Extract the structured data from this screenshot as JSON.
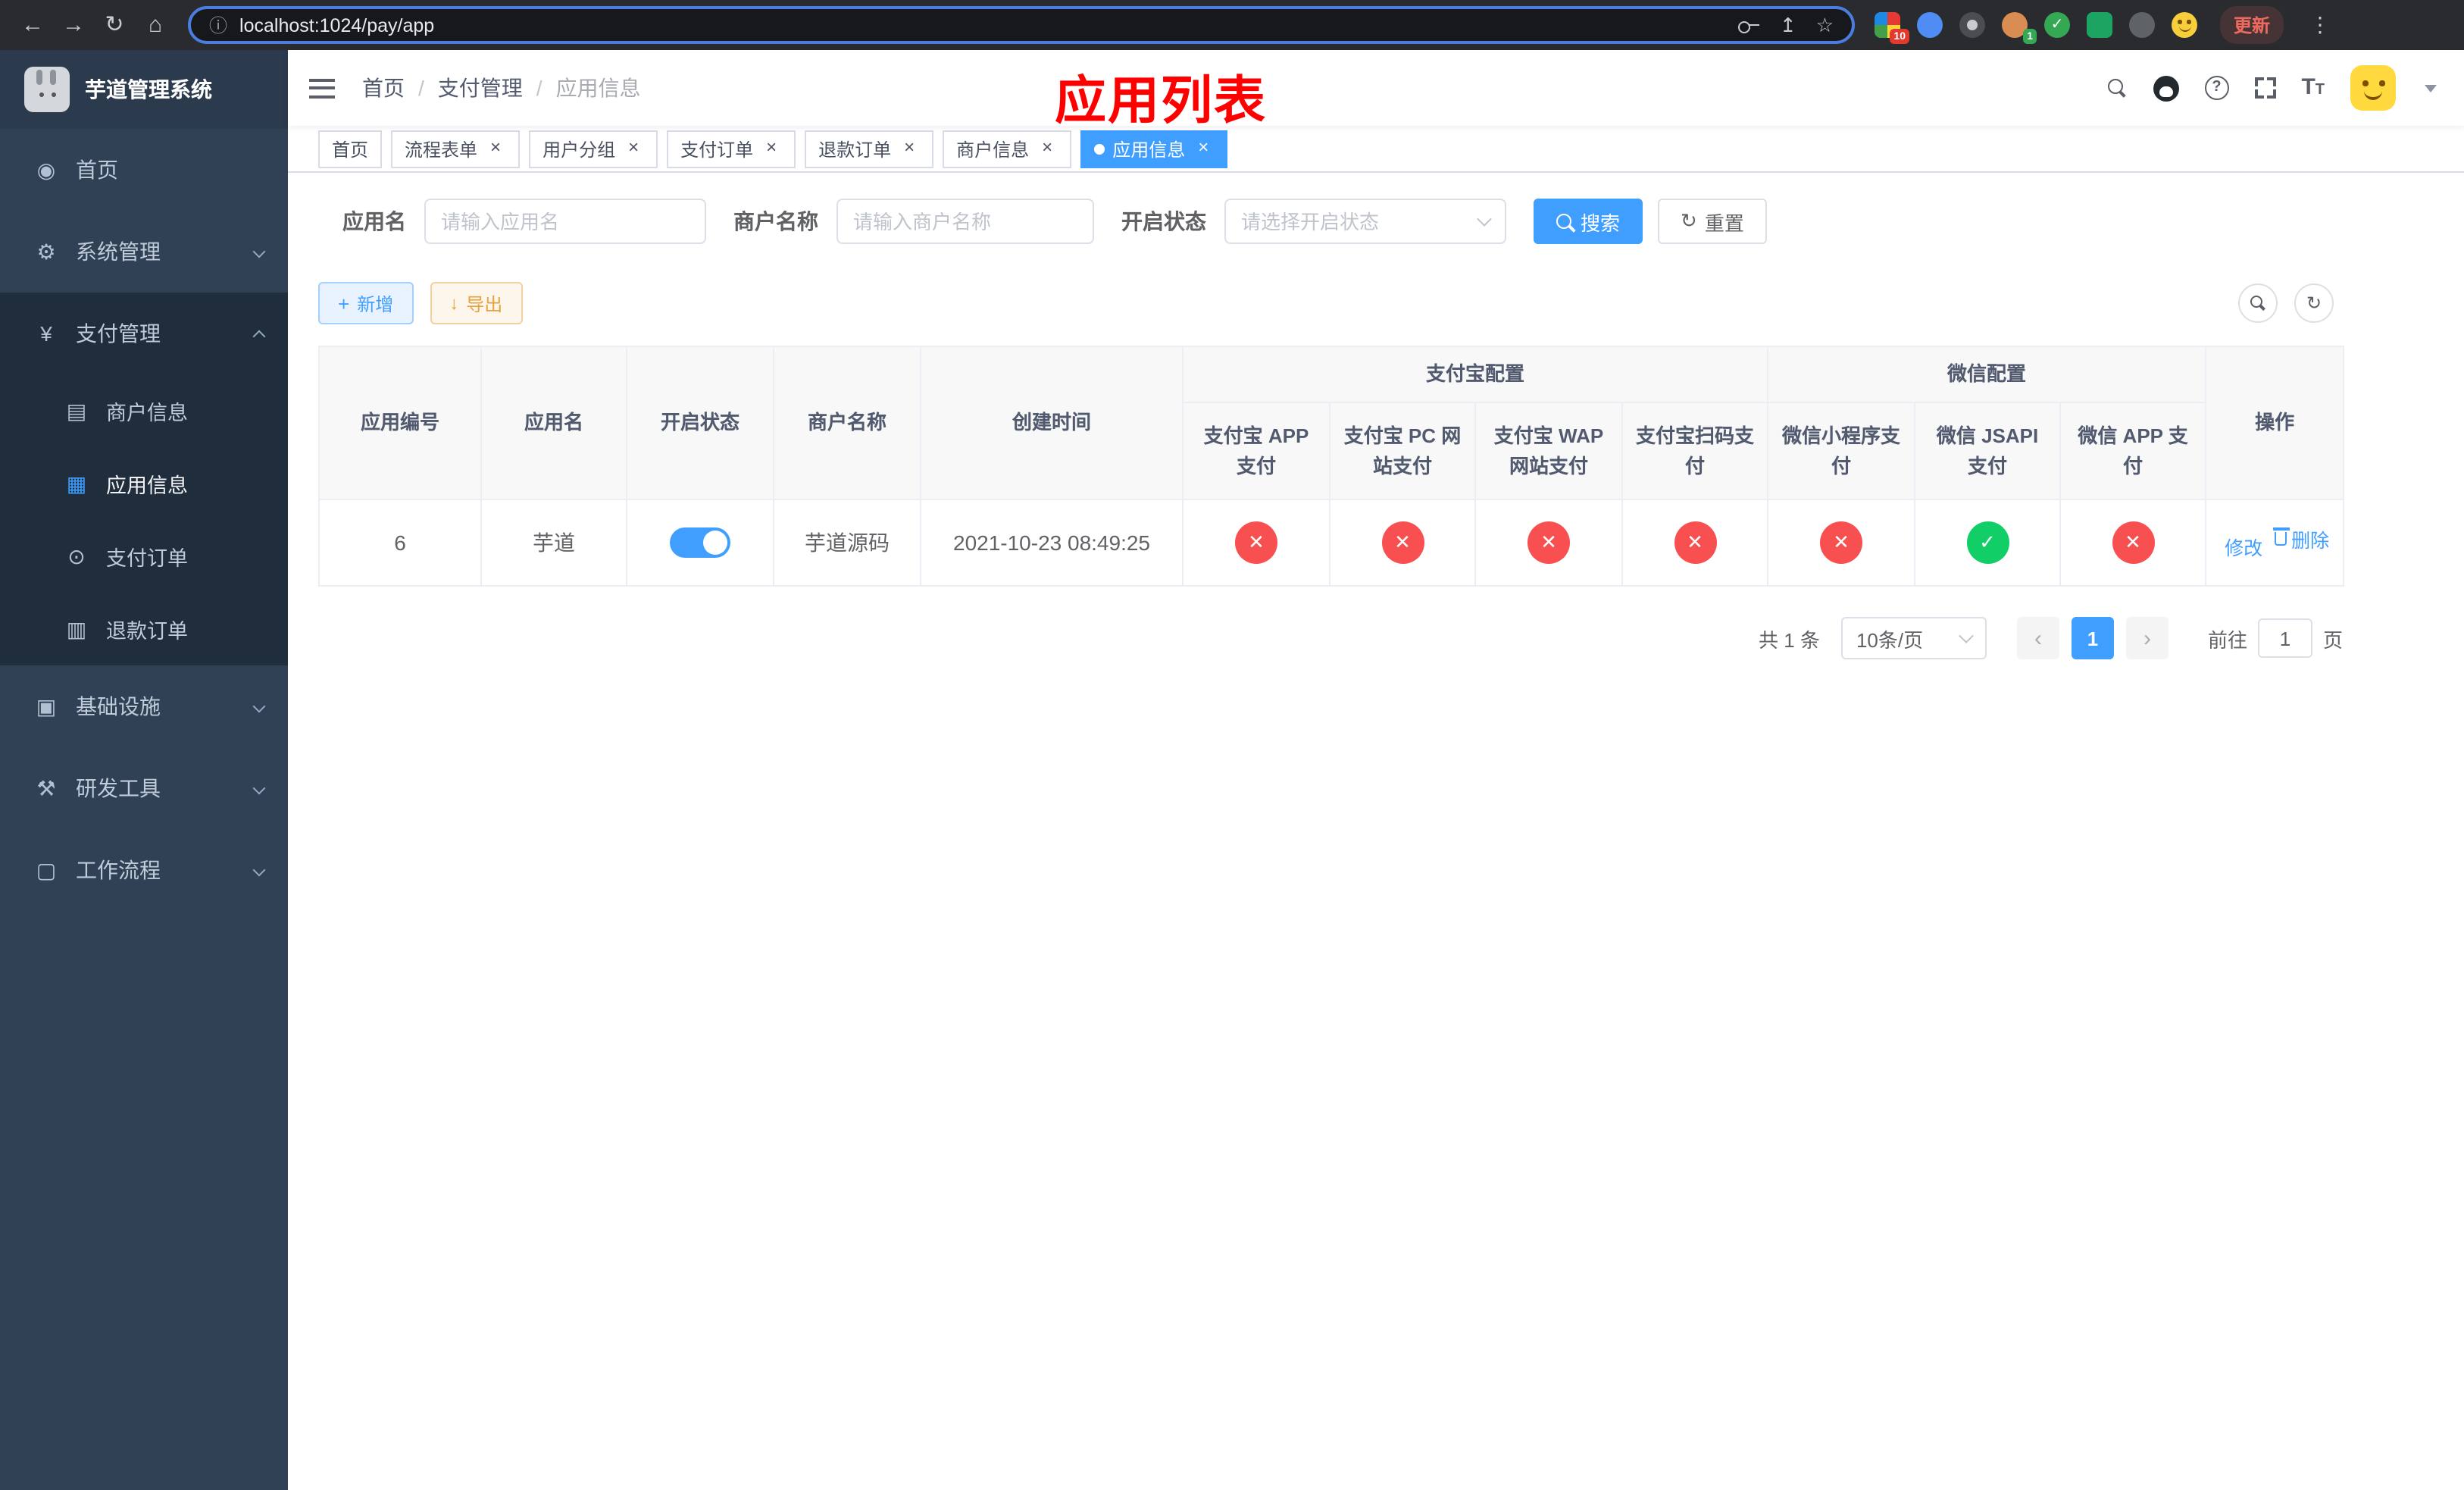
{
  "colors": {
    "primary": "#409eff",
    "danger": "#f85050",
    "success": "#12ce66",
    "warning": "#e6a23c",
    "sidebar_bg": "#304156",
    "sidebar_sub_bg": "#1f2d3d",
    "overlay_red": "#ff0000"
  },
  "icons": {
    "back": "←",
    "forward": "→",
    "reload": "↻",
    "home": "⌂",
    "info": "ⓘ",
    "share": "↥",
    "star": "☆",
    "kebab": "⋮",
    "dashboard": "◉",
    "gear": "⚙",
    "yen": "¥",
    "card": "▤",
    "grid": "▦",
    "order": "⊙",
    "refund": "▥",
    "infra": "▣",
    "tools": "⚒",
    "workflow": "▢",
    "question": "?",
    "font": "T",
    "check": "✓",
    "cross": "✕",
    "prev": "‹",
    "next": "›"
  },
  "browser": {
    "url": "localhost:1024/pay/app",
    "update_label": "更新",
    "ext_badge_1": "10",
    "ext_badge_2": "1"
  },
  "sidebar": {
    "logo_title": "芋道管理系统",
    "items": {
      "home": "首页",
      "system": "系统管理",
      "pay": "支付管理",
      "merchant": "商户信息",
      "app": "应用信息",
      "order": "支付订单",
      "refund": "退款订单",
      "infra": "基础设施",
      "dev": "研发工具",
      "workflow": "工作流程"
    }
  },
  "breadcrumb": {
    "home": "首页",
    "pay": "支付管理",
    "app": "应用信息",
    "separator": "/"
  },
  "overlay_title": "应用列表",
  "tabs": [
    {
      "label": "首页"
    },
    {
      "label": "流程表单"
    },
    {
      "label": "用户分组"
    },
    {
      "label": "支付订单"
    },
    {
      "label": "退款订单"
    },
    {
      "label": "商户信息"
    },
    {
      "label": "应用信息"
    }
  ],
  "filters": {
    "app_name_label": "应用名",
    "app_name_placeholder": "请输入应用名",
    "merchant_label": "商户名称",
    "merchant_placeholder": "请输入商户名称",
    "status_label": "开启状态",
    "status_placeholder": "请选择开启状态",
    "search_button": "搜索",
    "reset_button": "重置"
  },
  "toolbar": {
    "add_button": "新增",
    "export_button": "导出"
  },
  "table": {
    "headers": {
      "id": "应用编号",
      "name": "应用名",
      "status": "开启状态",
      "merchant": "商户名称",
      "created": "创建时间",
      "alipay_group": "支付宝配置",
      "wechat_group": "微信配置",
      "alipay_app": "支付宝 APP 支付",
      "alipay_pc": "支付宝 PC 网站支付",
      "alipay_wap": "支付宝 WAP 网站支付",
      "alipay_scan": "支付宝扫码支付",
      "wechat_mini": "微信小程序支付",
      "wechat_jsapi": "微信 JSAPI 支付",
      "wechat_app": "微信 APP 支付",
      "ops": "操作"
    },
    "row": {
      "id": "6",
      "name": "芋道",
      "status_on": true,
      "merchant": "芋道源码",
      "created": "2021-10-23 08:49:25",
      "configs": [
        "no",
        "no",
        "no",
        "no",
        "no",
        "yes",
        "no"
      ],
      "edit": "修改",
      "delete": "删除"
    }
  },
  "pagination": {
    "total": "共 1 条",
    "page_size": "10条/页",
    "page": "1",
    "goto_prefix": "前往",
    "goto_value": "1",
    "goto_suffix": "页"
  }
}
